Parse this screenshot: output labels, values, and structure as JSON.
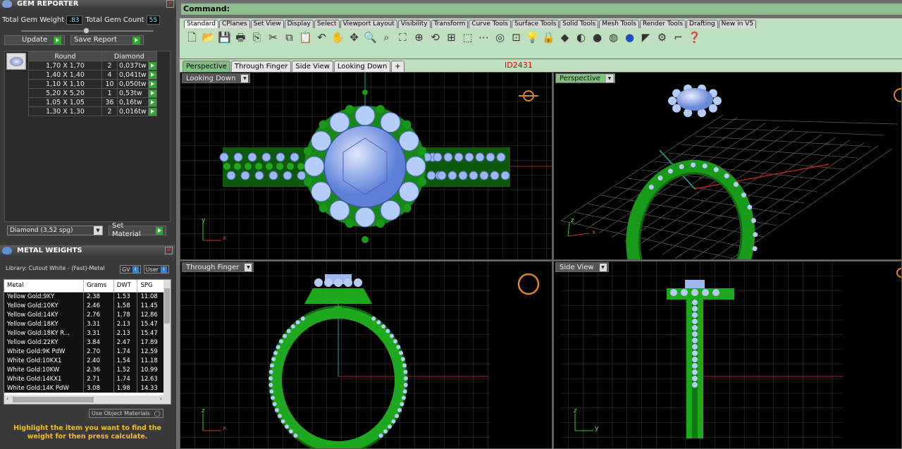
{
  "gem_reporter": {
    "title": "GEM REPORTER",
    "weight_label": "Total Gem Weight",
    "weight_value": ".83",
    "count_label": "Total Gem Count",
    "count_value": "55",
    "update_label": "Update",
    "save_label": "Save Report",
    "header_shape": "Round",
    "header_material": "Diamond",
    "rows": [
      {
        "size": "1,70 X 1,70",
        "count": "2",
        "weight": "0,037tw"
      },
      {
        "size": "1,40 X 1,40",
        "count": "4",
        "weight": "0,041tw"
      },
      {
        "size": "1,10 X 1,10",
        "count": "10",
        "weight": "0,050tw"
      },
      {
        "size": "5,20 X 5,20",
        "count": "1",
        "weight": "0,53tw"
      },
      {
        "size": "1,05 X 1,05",
        "count": "36",
        "weight": "0,16tw"
      },
      {
        "size": "1,30 X 1,30",
        "count": "2",
        "weight": "0,016tw"
      }
    ],
    "material_select": "Diamond    (3,52 spg)",
    "set_material_label": "Set Material"
  },
  "metal_weights": {
    "title": "METAL WEIGHTS",
    "library": "Library: Cutout White - (Fast)-Metal",
    "gv_label": "GV",
    "user_label": "User",
    "columns": [
      "Metal",
      "Grams",
      "DWT",
      "SPG"
    ],
    "rows": [
      [
        "Yellow Gold:9KY",
        "2.38",
        "1.53",
        "11.08"
      ],
      [
        "Yellow Gold:10KY",
        "2.46",
        "1.58",
        "11.45"
      ],
      [
        "Yellow Gold:14KY",
        "2.76",
        "1.78",
        "12.86"
      ],
      [
        "Yellow Gold:18KY",
        "3.31",
        "2.13",
        "15.47"
      ],
      [
        "Yellow Gold:18KY R...",
        "3.31",
        "2.13",
        "15.47"
      ],
      [
        "Yellow Gold:22KY",
        "3.84",
        "2.47",
        "17.89"
      ],
      [
        "White Gold:9K PdW",
        "2.70",
        "1.74",
        "12.59"
      ],
      [
        "White Gold:10KX1",
        "2.40",
        "1.54",
        "11.18"
      ],
      [
        "White Gold:10KW",
        "2.36",
        "1.52",
        "10.99"
      ],
      [
        "White Gold:14KX1",
        "2.71",
        "1.74",
        "12.63"
      ],
      [
        "White Gold:14K PdW",
        "3.08",
        "1.98",
        "14.33"
      ]
    ],
    "use_object_label": "Use Object Materials",
    "hint": "Highlight the item you want to find the weight for then press calculate."
  },
  "command": {
    "label": "Command:"
  },
  "toolbar_tabs": [
    "Standard",
    "CPlanes",
    "Set View",
    "Display",
    "Select",
    "Viewport Layout",
    "Visibility",
    "Transform",
    "Curve Tools",
    "Surface Tools",
    "Solid Tools",
    "Mesh Tools",
    "Render Tools",
    "Drafting",
    "New in V5"
  ],
  "viewport_tabs": [
    "Perspective",
    "Through Finger",
    "Side View",
    "Looking Down",
    "+"
  ],
  "id_label": "ID2431",
  "viewports": {
    "top_left": "Looking Down",
    "top_right": "Perspective",
    "bottom_left": "Through Finger",
    "bottom_right": "Side View"
  },
  "axis": {
    "x": "x",
    "y": "y",
    "z": "z"
  },
  "colors": {
    "metal": "#1fa81f",
    "gem": "#9db8f0",
    "toolbar": "#bfe0bf"
  }
}
